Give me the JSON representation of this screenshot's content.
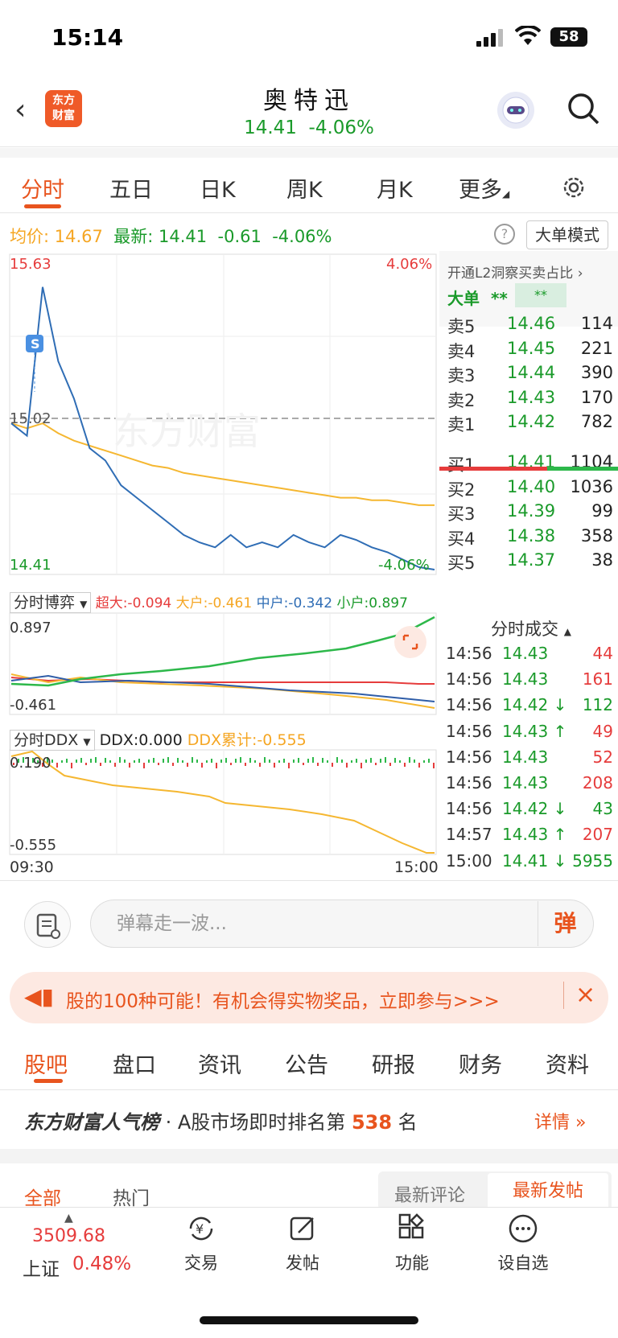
{
  "status_bar": {
    "time": "15:14",
    "battery": "58"
  },
  "header": {
    "name": "奥特迅",
    "price": "14.41",
    "change_pct": "-4.06%",
    "logo_line1": "东方",
    "logo_line2": "财富"
  },
  "chart_tabs": [
    "分时",
    "五日",
    "日K",
    "周K",
    "月K",
    "更多"
  ],
  "avg_row": {
    "avg_label": "均价:",
    "avg_value": "14.67",
    "latest_label": "最新:",
    "latest_value": "14.41",
    "change": "-0.61",
    "change_pct": "-4.06%",
    "big_mode": "大单模式",
    "help": "?"
  },
  "chart_labels": {
    "high": "15.63",
    "high_pct": "4.06%",
    "mid": "15.02",
    "low": "14.41",
    "low_pct": "-4.06%",
    "s_marker": "S",
    "watermark": "东方财富",
    "game_title": "分时博弈",
    "super": "超大:-0.094",
    "large": "大户:-0.461",
    "medium": "中户:-0.342",
    "small": "小户:0.897",
    "game_top": "0.897",
    "game_bottom": "-0.461",
    "ddx_title": "分时DDX",
    "ddx_value": "DDX:0.000",
    "ddx_cum": "DDX累计:-0.555",
    "ddx_top": "0.190",
    "ddx_bottom": "-0.555",
    "time_start": "09:30",
    "time_end": "15:00"
  },
  "chart_data": {
    "type": "line",
    "x_range": [
      "09:30",
      "15:00"
    ],
    "ylim": [
      14.41,
      15.63
    ],
    "series": [
      {
        "values": [
          15.0,
          14.95,
          15.55,
          15.25,
          15.1,
          14.9,
          14.85,
          14.75,
          14.7,
          14.65,
          14.6,
          14.55,
          14.52,
          14.5,
          14.55,
          14.5,
          14.52,
          14.5,
          14.55,
          14.52,
          14.5,
          14.55,
          14.53,
          14.5,
          14.48,
          14.45,
          14.42,
          14.41
        ]
      },
      {
        "values": [
          15.0,
          14.98,
          15.0,
          14.96,
          14.93,
          14.91,
          14.89,
          14.87,
          14.85,
          14.83,
          14.82,
          14.8,
          14.79,
          14.78,
          14.77,
          14.76,
          14.75,
          14.74,
          14.73,
          14.72,
          14.71,
          14.7,
          14.7,
          14.69,
          14.69,
          14.68,
          14.67,
          14.67
        ]
      }
    ]
  },
  "right_panel": {
    "l2": "开通L2洞察买卖占比 ›",
    "big_label": "大单",
    "big_stars": "**",
    "big_box": "**",
    "sells": [
      {
        "label": "卖5",
        "price": "14.46",
        "vol": "114"
      },
      {
        "label": "卖4",
        "price": "14.45",
        "vol": "221"
      },
      {
        "label": "卖3",
        "price": "14.44",
        "vol": "390"
      },
      {
        "label": "卖2",
        "price": "14.43",
        "vol": "170"
      },
      {
        "label": "卖1",
        "price": "14.42",
        "vol": "782"
      }
    ],
    "buys": [
      {
        "label": "买1",
        "price": "14.41",
        "vol": "1104"
      },
      {
        "label": "买2",
        "price": "14.40",
        "vol": "1036"
      },
      {
        "label": "买3",
        "price": "14.39",
        "vol": "99"
      },
      {
        "label": "买4",
        "price": "14.38",
        "vol": "358"
      },
      {
        "label": "买5",
        "price": "14.37",
        "vol": "38"
      }
    ],
    "trades_title": "分时成交",
    "trades": [
      {
        "time": "14:56",
        "price": "14.43",
        "vol": "44",
        "dir": "",
        "color": "#e63c3c"
      },
      {
        "time": "14:56",
        "price": "14.43",
        "vol": "161",
        "dir": "",
        "color": "#e63c3c"
      },
      {
        "time": "14:56",
        "price": "14.42",
        "vol": "112",
        "dir": "↓",
        "color": "#1a9a2a"
      },
      {
        "time": "14:56",
        "price": "14.43",
        "vol": "49",
        "dir": "↑",
        "color": "#e63c3c"
      },
      {
        "time": "14:56",
        "price": "14.43",
        "vol": "52",
        "dir": "",
        "color": "#e63c3c"
      },
      {
        "time": "14:56",
        "price": "14.43",
        "vol": "208",
        "dir": "",
        "color": "#e63c3c"
      },
      {
        "time": "14:56",
        "price": "14.42",
        "vol": "43",
        "dir": "↓",
        "color": "#1a9a2a"
      },
      {
        "time": "14:57",
        "price": "14.43",
        "vol": "207",
        "dir": "↑",
        "color": "#e63c3c"
      },
      {
        "time": "15:00",
        "price": "14.41",
        "vol": "5955",
        "dir": "↓",
        "color": "#1a9a2a"
      }
    ]
  },
  "danmu": {
    "placeholder": "弹幕走一波...",
    "send": "弹"
  },
  "banner": {
    "text": "股的100种可能！有机会得实物奖品，立即参与>>>"
  },
  "bottom_tabs": [
    "股吧",
    "盘口",
    "资讯",
    "公告",
    "研报",
    "财务",
    "资料"
  ],
  "rank": {
    "brand": "东方财富人气榜",
    "text": " · A股市场即时排名第 ",
    "num": "538",
    "suffix": " 名",
    "detail": "详情 »"
  },
  "sub_tabs": {
    "all": "全部",
    "hot": "热门",
    "latest_comment": "最新评论",
    "latest_post": "最新发帖"
  },
  "bottom_nav": {
    "index_value": "3509.68",
    "index_name": "上证",
    "index_change": "0.48%",
    "items": [
      "交易",
      "发帖",
      "功能",
      "设自选"
    ]
  }
}
